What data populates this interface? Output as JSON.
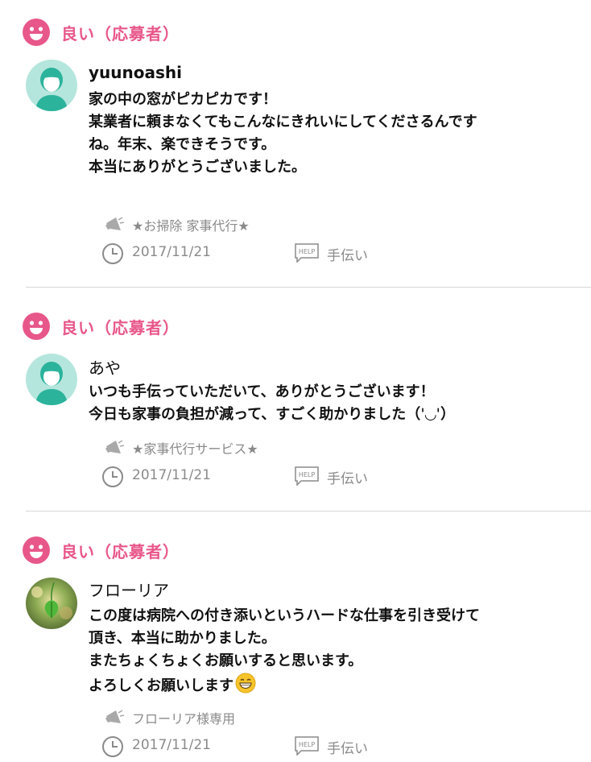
{
  "colors": {
    "accent": "#e8578a",
    "meta": "#8a8a8a",
    "avatar_bg": "#b5e6dd",
    "avatar_fg": "#2bb39c"
  },
  "reviews": [
    {
      "rating_label": "良い（応募者）",
      "author": "yuunoashi",
      "avatar": "default-person-icon",
      "lines": [
        "家の中の窓がピカピカです！",
        "某業者に頼まなくてもこんなにきれいにしてくださるんです",
        "ね。年末、楽できそうです。",
        "本当にありがとうございました。"
      ],
      "job_title": "★お掃除 家事代行★",
      "date": "2017/11/21",
      "help_icon_text": "HELP",
      "category": "手伝い"
    },
    {
      "rating_label": "良い（応募者）",
      "author": "あや",
      "avatar": "default-person-icon",
      "lines": [
        "いつも手伝っていただいて、ありがとうございます！",
        "今日も家事の負担が減って、すごく助かりました（ˈ◡ˈ）"
      ],
      "job_title": "★家事代行サービス★",
      "date": "2017/11/21",
      "help_icon_text": "HELP",
      "category": "手伝い"
    },
    {
      "rating_label": "良い（応募者）",
      "author": "フローリア",
      "avatar": "leaf-photo",
      "lines": [
        "この度は病院への付き添いというハードな仕事を引き受けて",
        "頂き、本当に助かりました。",
        "またちょくちょくお願いすると思います。",
        "よろしくお願いします"
      ],
      "job_title": "フローリア様専用",
      "date": "2017/11/21",
      "help_icon_text": "HELP",
      "category": "手伝い"
    }
  ]
}
